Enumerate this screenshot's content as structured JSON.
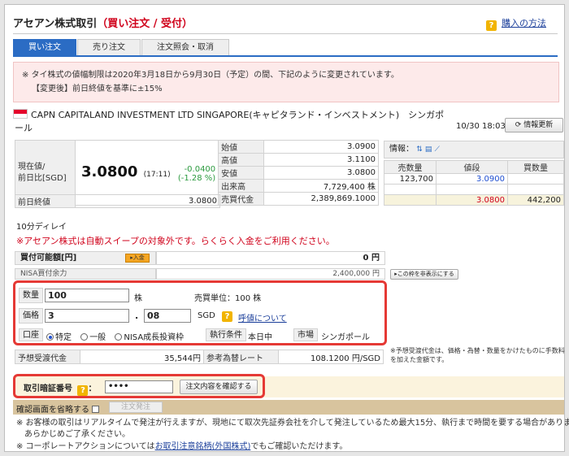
{
  "header": {
    "title_main": "アセアン株式取引",
    "title_sub": "（買い注文 / 受付）",
    "help_label": "購入の方法"
  },
  "tabs": [
    {
      "label": "買い注文",
      "active": true
    },
    {
      "label": "売り注文",
      "active": false
    },
    {
      "label": "注文照会・取消",
      "active": false
    }
  ],
  "notice": {
    "line1": "※ タイ株式の値幅制限は2020年3月18日から9月30日（予定）の間、下記のように変更されています。",
    "line2": "【変更後】前日終値を基準に±15%"
  },
  "stock": {
    "name_line1": "CAPN CAPITALAND INVESTMENT LTD SINGAPORE(キャピタランド・インベストメント)　シンガポ",
    "name_line2": "ール",
    "timestamp": "10/30 18:03",
    "refresh_label": "情報更新"
  },
  "quote": {
    "current_label_1": "現在値/",
    "current_label_2": "前日比[SGD]",
    "price": "3.0800",
    "price_time": "(17:11)",
    "change": "-0.0400",
    "change_pct": "(-1.28 %)",
    "prev_close_label": "前日終値",
    "prev_close": "3.0800",
    "rows": [
      {
        "label": "始値",
        "value": "3.0900"
      },
      {
        "label": "高値",
        "value": "3.1100"
      },
      {
        "label": "安値",
        "value": "3.0800"
      },
      {
        "label": "出来高",
        "value": "7,729,400 株"
      },
      {
        "label": "売買代金",
        "value": "2,389,869.1000"
      }
    ]
  },
  "board": {
    "info_label": "情報：",
    "col_sell": "売数量",
    "col_price": "値段",
    "col_buy": "買数量",
    "ask": {
      "qty": "123,700",
      "price": "3.0900"
    },
    "bid": {
      "price": "3.0800",
      "qty": "442,200"
    }
  },
  "delay_text": "10分ディレイ",
  "sweep_text": "※アセアン株式は自動スイープの対象外です。らくらく入金をご利用ください。",
  "budget": {
    "label": "買付可能額[円]",
    "tag": "入金",
    "value": "0 円",
    "nisa_label": "NISA買付余力",
    "nisa_value": "2,400,000 円",
    "hide_label": "この枠を非表示にする"
  },
  "order": {
    "qty_label": "数量",
    "qty_value": "100",
    "qty_unit": "株",
    "lot_text": "売買単位：100 株",
    "price_label": "価格",
    "price_int": "3",
    "price_dot": ".",
    "price_dec": "08",
    "price_unit": "SGD",
    "tick_link": "呼値について",
    "account_label": "口座",
    "acct_specific": "特定",
    "acct_general": "一般",
    "acct_nisa": "NISA成長投資枠",
    "cond_label": "執行条件",
    "cond_value": "本日中",
    "market_label": "市場",
    "market_value": "シンガポール"
  },
  "estimate": {
    "est_label": "予想受渡代金",
    "est_value": "35,544円",
    "fx_label": "参考為替レート",
    "fx_value": "108.1200 円/SGD",
    "note": "※予想受渡代金は、価格・為替・数量をかけたものに手数料を加えた金額です。"
  },
  "password": {
    "label": "取引暗証番号",
    "colon": "：",
    "value": "••••",
    "confirm_button": "注文内容を確認する"
  },
  "skip": {
    "label": "確認画面を省略する",
    "submit_button": "注文発注"
  },
  "footer": {
    "line1": "※ お客様の取引はリアルタイムで発注が行えますが、現地にて取次先証券会社を介して発注しているため最大15分、執行まで時間を要する場合があります。",
    "line2": "あらかじめご了承ください。",
    "line3_pre": "※ コーポレートアクションについては",
    "line3_link": "お取引注意銘柄(外国株式)",
    "line3_post": "でもご確認いただけます。"
  }
}
